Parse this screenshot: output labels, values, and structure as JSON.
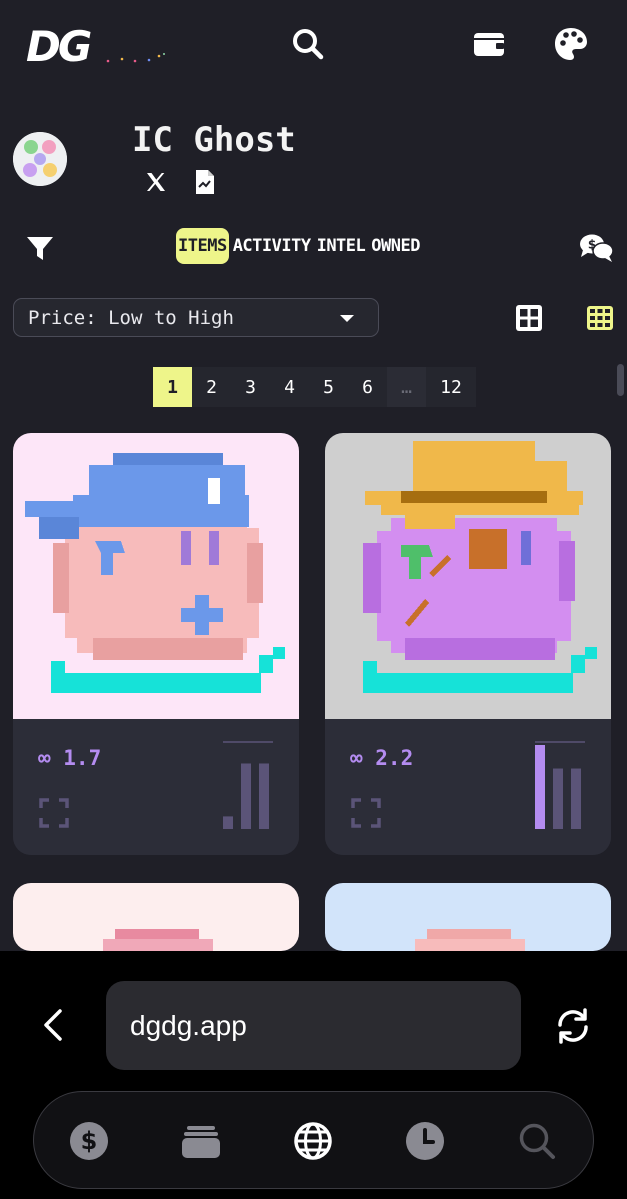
{
  "app": {
    "logo": "DG"
  },
  "header": {
    "icons": [
      "search-icon",
      "wallet-icon",
      "palette-icon"
    ]
  },
  "collection": {
    "name": "IC Ghost",
    "socials": [
      "x-icon",
      "document-icon"
    ]
  },
  "tabs": [
    {
      "label": "ITEMS",
      "active": true
    },
    {
      "label": "ACTIVITY",
      "active": false
    },
    {
      "label": "INTEL",
      "active": false
    },
    {
      "label": "OWNED",
      "active": false
    }
  ],
  "sort": {
    "selected": "Price: Low to High"
  },
  "pagination": {
    "pages": [
      "1",
      "2",
      "3",
      "4",
      "5",
      "6",
      "…",
      "12"
    ],
    "current": "1"
  },
  "items": [
    {
      "price": "∞ 1.7",
      "background": "#fde6f8",
      "activity_bars": [
        0.15,
        0.78,
        0.78
      ],
      "highlight_bar": -1
    },
    {
      "price": "∞ 2.2",
      "background": "#cfcfcf",
      "activity_bars": [
        1.0,
        0.72,
        0.72
      ],
      "highlight_bar": 0
    }
  ],
  "browser": {
    "url": "dgdg.app",
    "nav_icons": [
      "dollar-icon",
      "cards-icon",
      "globe-icon",
      "clock-icon",
      "search-icon"
    ],
    "active_nav": "globe-icon"
  },
  "colors": {
    "background": "#1f1f27",
    "accent": "#eef58a",
    "price": "#b48cf0",
    "card": "#2c2d38"
  }
}
